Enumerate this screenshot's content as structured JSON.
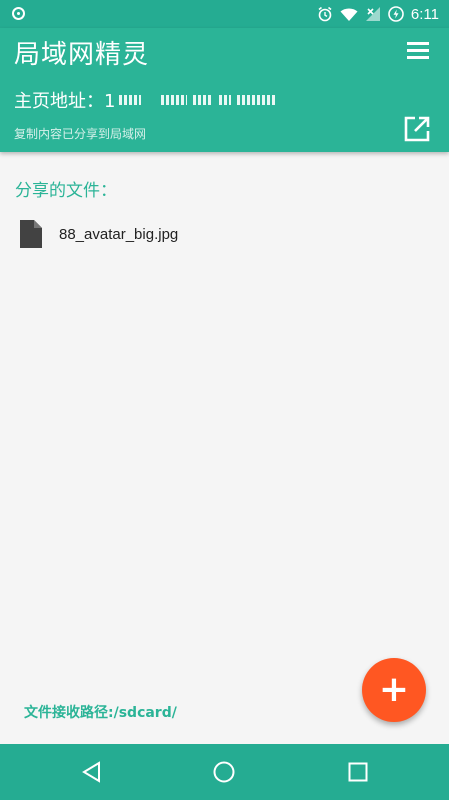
{
  "status_bar": {
    "time": "6:11",
    "icons": [
      "alarm-icon",
      "wifi-icon",
      "signal-icon",
      "battery-icon"
    ]
  },
  "app_bar": {
    "title": "局域网精灵",
    "home_address_label": "主页地址：1",
    "copy_hint": "复制内容已分享到局域网"
  },
  "main": {
    "section_title": "分享的文件：",
    "files": [
      {
        "name": "88_avatar_big.jpg",
        "icon": "file-icon"
      }
    ],
    "receive_path": "文件接收路径:/sdcard/",
    "fab_label": "+"
  },
  "nav_bar": {
    "buttons": [
      "back-icon",
      "home-icon",
      "recents-icon"
    ]
  },
  "colors": {
    "primary": "#2bb497",
    "status": "#25ac92",
    "accent": "#ff5722"
  }
}
